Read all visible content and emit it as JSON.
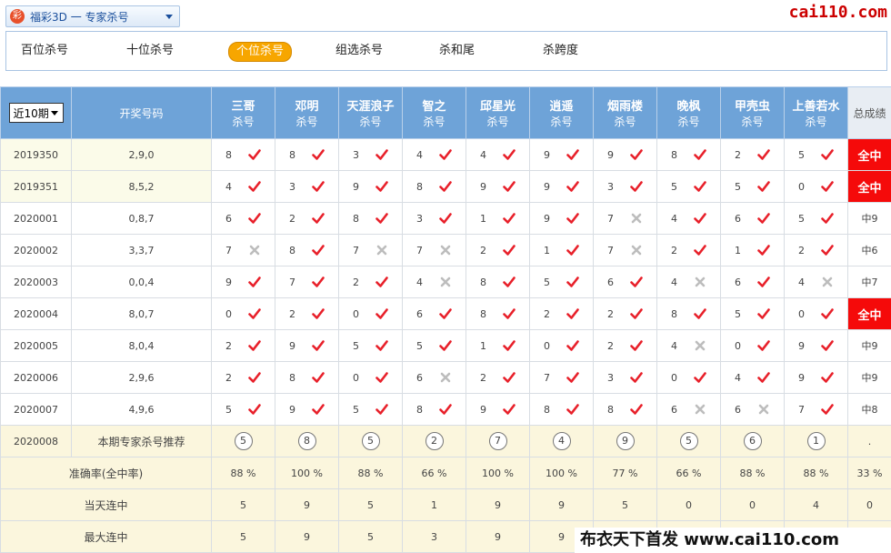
{
  "header": {
    "game_title": "福彩3D 一 专家杀号",
    "logo_text": "彩",
    "watermark": "cai110.com"
  },
  "tabs": [
    {
      "label": "百位杀号",
      "active": false
    },
    {
      "label": "十位杀号",
      "active": false
    },
    {
      "label": "个位杀号",
      "active": true
    },
    {
      "label": "组选杀号",
      "active": false
    },
    {
      "label": "杀和尾",
      "active": false
    },
    {
      "label": "杀跨度",
      "active": false
    }
  ],
  "table": {
    "range_select": "近10期",
    "col_draw": "开奖号码",
    "col_total": "总成绩",
    "experts": [
      {
        "name": "三哥",
        "sub": "杀号"
      },
      {
        "name": "邓明",
        "sub": "杀号"
      },
      {
        "name": "天涯浪子",
        "sub": "杀号"
      },
      {
        "name": "智之",
        "sub": "杀号"
      },
      {
        "name": "邱星光",
        "sub": "杀号"
      },
      {
        "name": "逍遥",
        "sub": "杀号"
      },
      {
        "name": "烟雨楼",
        "sub": "杀号"
      },
      {
        "name": "晚枫",
        "sub": "杀号"
      },
      {
        "name": "甲壳虫",
        "sub": "杀号"
      },
      {
        "name": "上善若水",
        "sub": "杀号"
      }
    ],
    "rows": [
      {
        "period": "2019350",
        "draw": "2,9,0",
        "picks": [
          "8",
          "8",
          "3",
          "4",
          "4",
          "9",
          "9",
          "8",
          "2",
          "5"
        ],
        "hits": [
          1,
          1,
          1,
          1,
          1,
          1,
          1,
          1,
          1,
          1
        ],
        "total": "全中",
        "win": true
      },
      {
        "period": "2019351",
        "draw": "8,5,2",
        "picks": [
          "4",
          "3",
          "9",
          "8",
          "9",
          "9",
          "3",
          "5",
          "5",
          "0"
        ],
        "hits": [
          1,
          1,
          1,
          1,
          1,
          1,
          1,
          1,
          1,
          1
        ],
        "total": "全中",
        "win": true
      },
      {
        "period": "2020001",
        "draw": "0,8,7",
        "picks": [
          "6",
          "2",
          "8",
          "3",
          "1",
          "9",
          "7",
          "4",
          "6",
          "5"
        ],
        "hits": [
          1,
          1,
          1,
          1,
          1,
          1,
          0,
          1,
          1,
          1
        ],
        "total": "中9",
        "win": false
      },
      {
        "period": "2020002",
        "draw": "3,3,7",
        "picks": [
          "7",
          "8",
          "7",
          "7",
          "2",
          "1",
          "7",
          "2",
          "1",
          "2"
        ],
        "hits": [
          0,
          1,
          0,
          0,
          1,
          1,
          0,
          1,
          1,
          1
        ],
        "total": "中6",
        "win": false
      },
      {
        "period": "2020003",
        "draw": "0,0,4",
        "picks": [
          "9",
          "7",
          "2",
          "4",
          "8",
          "5",
          "6",
          "4",
          "6",
          "4"
        ],
        "hits": [
          1,
          1,
          1,
          0,
          1,
          1,
          1,
          0,
          1,
          0
        ],
        "total": "中7",
        "win": false
      },
      {
        "period": "2020004",
        "draw": "8,0,7",
        "picks": [
          "0",
          "2",
          "0",
          "6",
          "8",
          "2",
          "2",
          "8",
          "5",
          "0"
        ],
        "hits": [
          1,
          1,
          1,
          1,
          1,
          1,
          1,
          1,
          1,
          1
        ],
        "total": "全中",
        "win": true
      },
      {
        "period": "2020005",
        "draw": "8,0,4",
        "picks": [
          "2",
          "9",
          "5",
          "5",
          "1",
          "0",
          "2",
          "4",
          "0",
          "9"
        ],
        "hits": [
          1,
          1,
          1,
          1,
          1,
          1,
          1,
          0,
          1,
          1
        ],
        "total": "中9",
        "win": false
      },
      {
        "period": "2020006",
        "draw": "2,9,6",
        "picks": [
          "2",
          "8",
          "0",
          "6",
          "2",
          "7",
          "3",
          "0",
          "4",
          "9"
        ],
        "hits": [
          1,
          1,
          1,
          0,
          1,
          1,
          1,
          1,
          1,
          1
        ],
        "total": "中9",
        "win": false
      },
      {
        "period": "2020007",
        "draw": "4,9,6",
        "picks": [
          "5",
          "9",
          "5",
          "8",
          "9",
          "8",
          "8",
          "6",
          "6",
          "7"
        ],
        "hits": [
          1,
          1,
          1,
          1,
          1,
          1,
          1,
          0,
          0,
          1
        ],
        "total": "中8",
        "win": false
      }
    ],
    "recommend": {
      "period": "2020008",
      "label": "本期专家杀号推荐",
      "picks": [
        "5",
        "8",
        "5",
        "2",
        "7",
        "4",
        "9",
        "5",
        "6",
        "1"
      ],
      "total": "."
    },
    "stats": [
      {
        "label": "准确率(全中率)",
        "values": [
          "88 %",
          "100 %",
          "88 %",
          "66 %",
          "100 %",
          "100 %",
          "77 %",
          "66 %",
          "88 %",
          "88 %"
        ],
        "total": "33 %"
      },
      {
        "label": "当天连中",
        "values": [
          "5",
          "9",
          "5",
          "1",
          "9",
          "9",
          "5",
          "0",
          "0",
          "4"
        ],
        "total": "0"
      },
      {
        "label": "最大连中",
        "values": [
          "5",
          "9",
          "5",
          "3",
          "9",
          "9",
          "",
          "",
          "",
          ""
        ],
        "total": ""
      }
    ]
  },
  "footer": {
    "watermark": "布衣天下首发 www.cai110.com"
  },
  "colors": {
    "header_blue": "#6ea3d8",
    "check_red": "#e8202a",
    "cross_gray": "#bdbdbd",
    "win_red": "#f50a0a",
    "active_tab": "#f7a600"
  }
}
